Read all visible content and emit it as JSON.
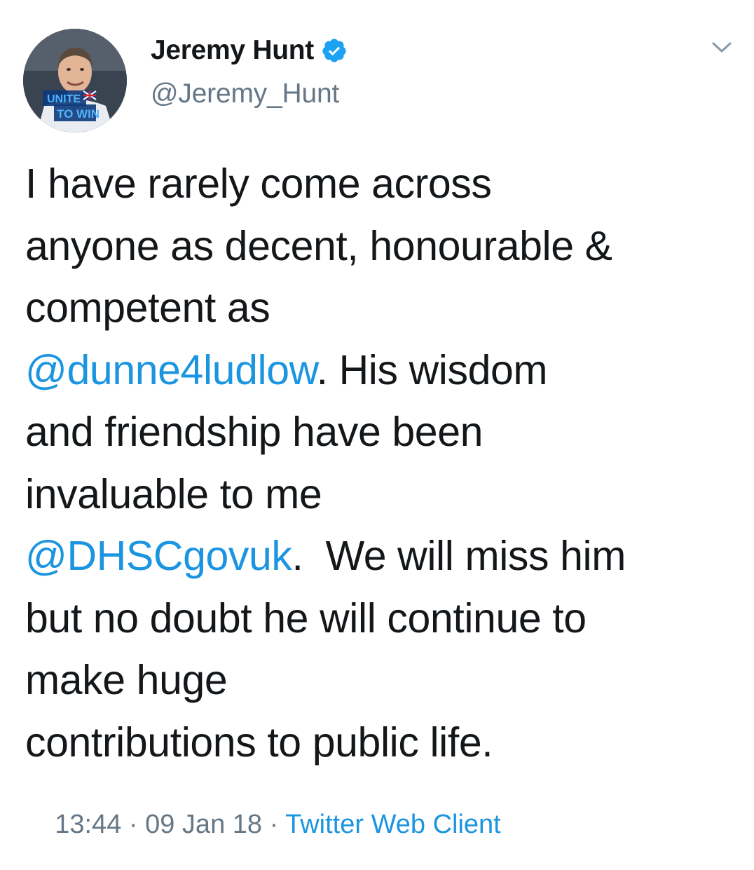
{
  "author": {
    "display_name": "Jeremy Hunt",
    "handle": "@Jeremy_Hunt",
    "verified": true,
    "avatar_badge_line1": "UNITE",
    "avatar_badge_line2": "TO WIN"
  },
  "tweet": {
    "lines": [
      {
        "segments": [
          {
            "text": "I have rarely come across",
            "mention": false
          }
        ]
      },
      {
        "segments": [
          {
            "text": "anyone as decent, honourable &",
            "mention": false
          }
        ]
      },
      {
        "segments": [
          {
            "text": "competent as",
            "mention": false
          }
        ]
      },
      {
        "segments": [
          {
            "text": "@dunne4ludlow",
            "mention": true
          },
          {
            "text": ". His wisdom",
            "mention": false
          }
        ]
      },
      {
        "segments": [
          {
            "text": "and friendship have been",
            "mention": false
          }
        ]
      },
      {
        "segments": [
          {
            "text": "invaluable to me",
            "mention": false
          }
        ]
      },
      {
        "segments": [
          {
            "text": "@DHSCgovuk",
            "mention": true
          },
          {
            "text": ".  We will miss him",
            "mention": false
          }
        ]
      },
      {
        "segments": [
          {
            "text": "but no doubt he will continue to",
            "mention": false
          }
        ]
      },
      {
        "segments": [
          {
            "text": "make huge",
            "mention": false
          }
        ]
      },
      {
        "segments": [
          {
            "text": "contributions to public life.",
            "mention": false
          }
        ]
      }
    ]
  },
  "meta": {
    "time": "13:44",
    "separator": " · ",
    "date": "09 Jan 18",
    "client": "Twitter Web Client"
  },
  "icons": {
    "verified": "verified-badge-icon",
    "menu": "chevron-down-icon"
  },
  "colors": {
    "text": "#14171a",
    "secondary": "#657786",
    "link": "#1b95e0",
    "verified": "#1da1f2"
  }
}
